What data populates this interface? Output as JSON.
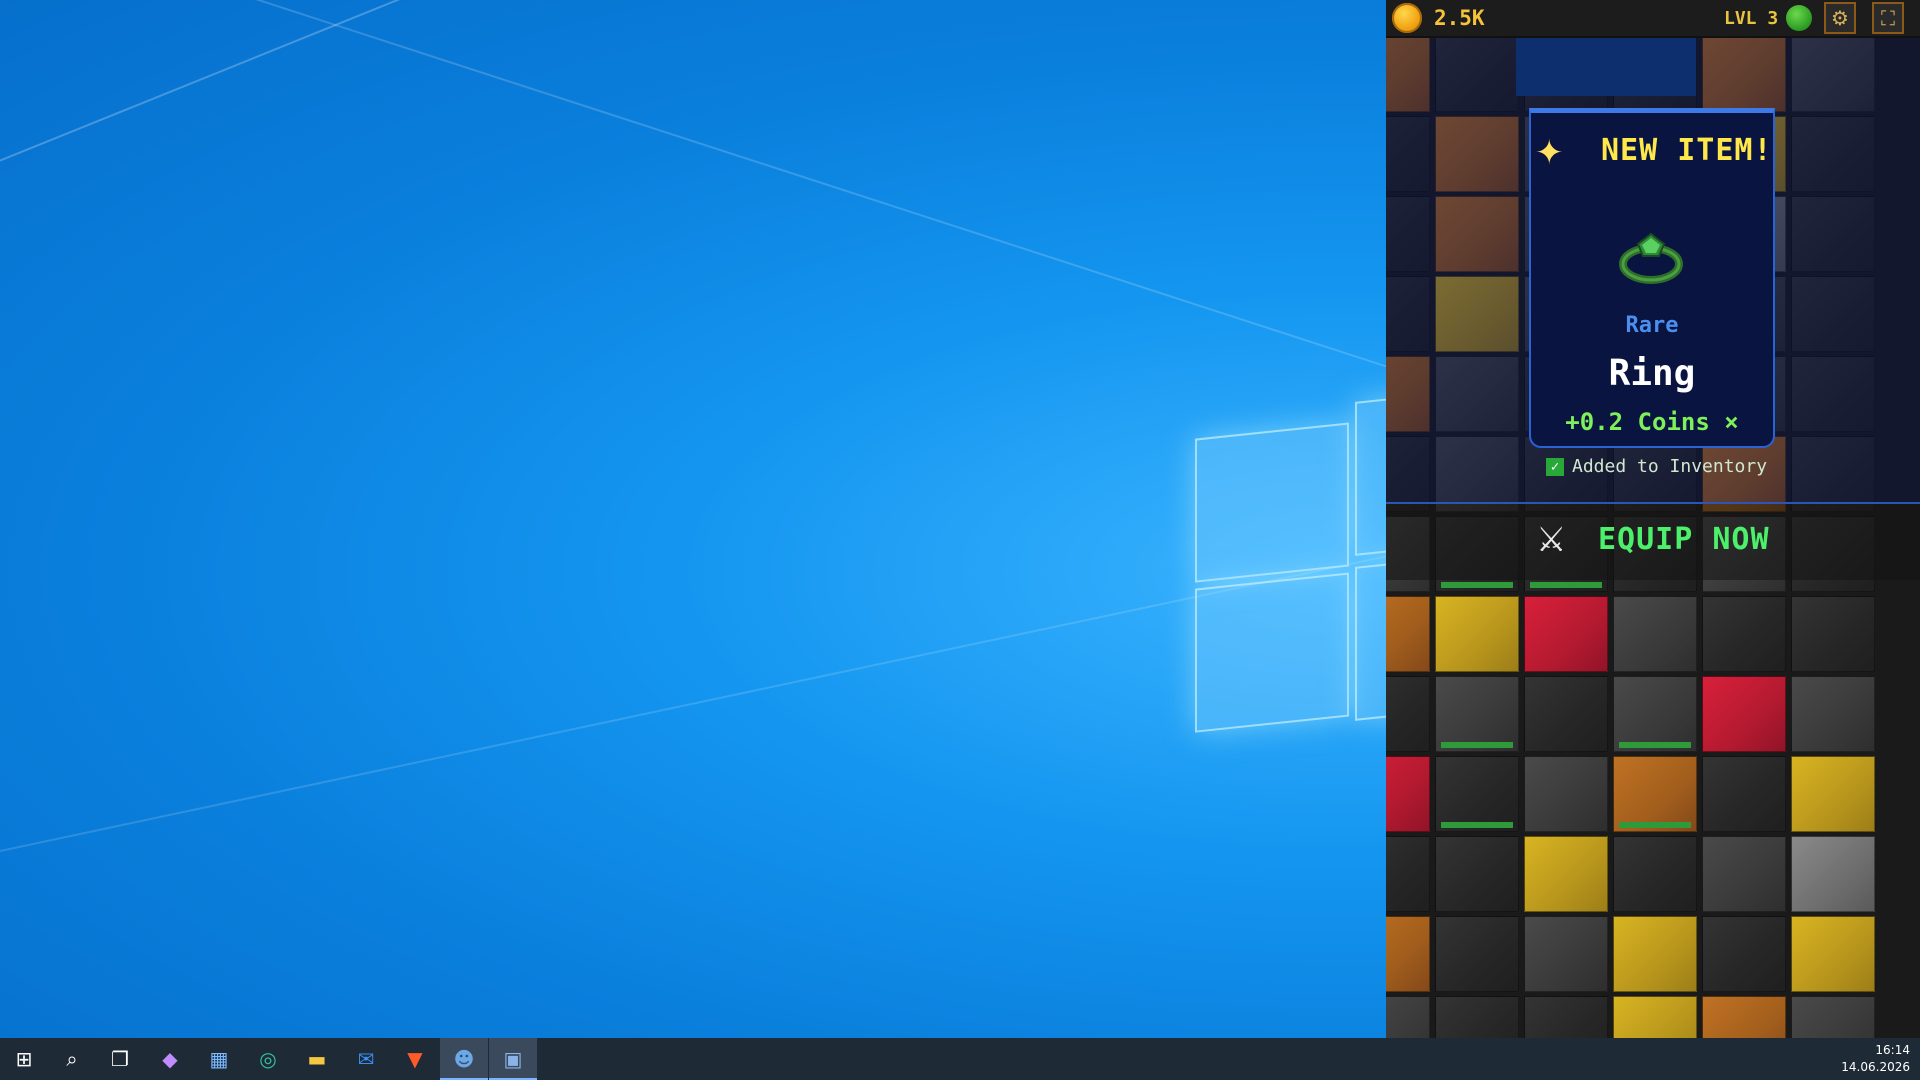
{
  "game": {
    "coins": "2.5K",
    "level": "LVL 3",
    "settings_icon": "gear-icon",
    "fullscreen_icon": "fullscreen-icon"
  },
  "new_item": {
    "title": "NEW ITEM!",
    "rarity": "Rare",
    "name": "Ring",
    "bonus": "+0.2  Coins ×",
    "added": "Added to Inventory",
    "equip": "EQUIP NOW",
    "colors": {
      "rarity": "#4a8ef0",
      "title": "#ffe84a",
      "bonus": "#7ef05a"
    }
  },
  "taskbar": {
    "icons": [
      "windows-start-icon",
      "search-icon",
      "task-view-icon",
      "copilot-icon",
      "store-icon",
      "edge-icon",
      "file-explorer-icon",
      "outlook-icon",
      "brave-icon",
      "godot-icon",
      "game-app-icon"
    ],
    "time": "16:14",
    "date": "14.06.2026"
  }
}
